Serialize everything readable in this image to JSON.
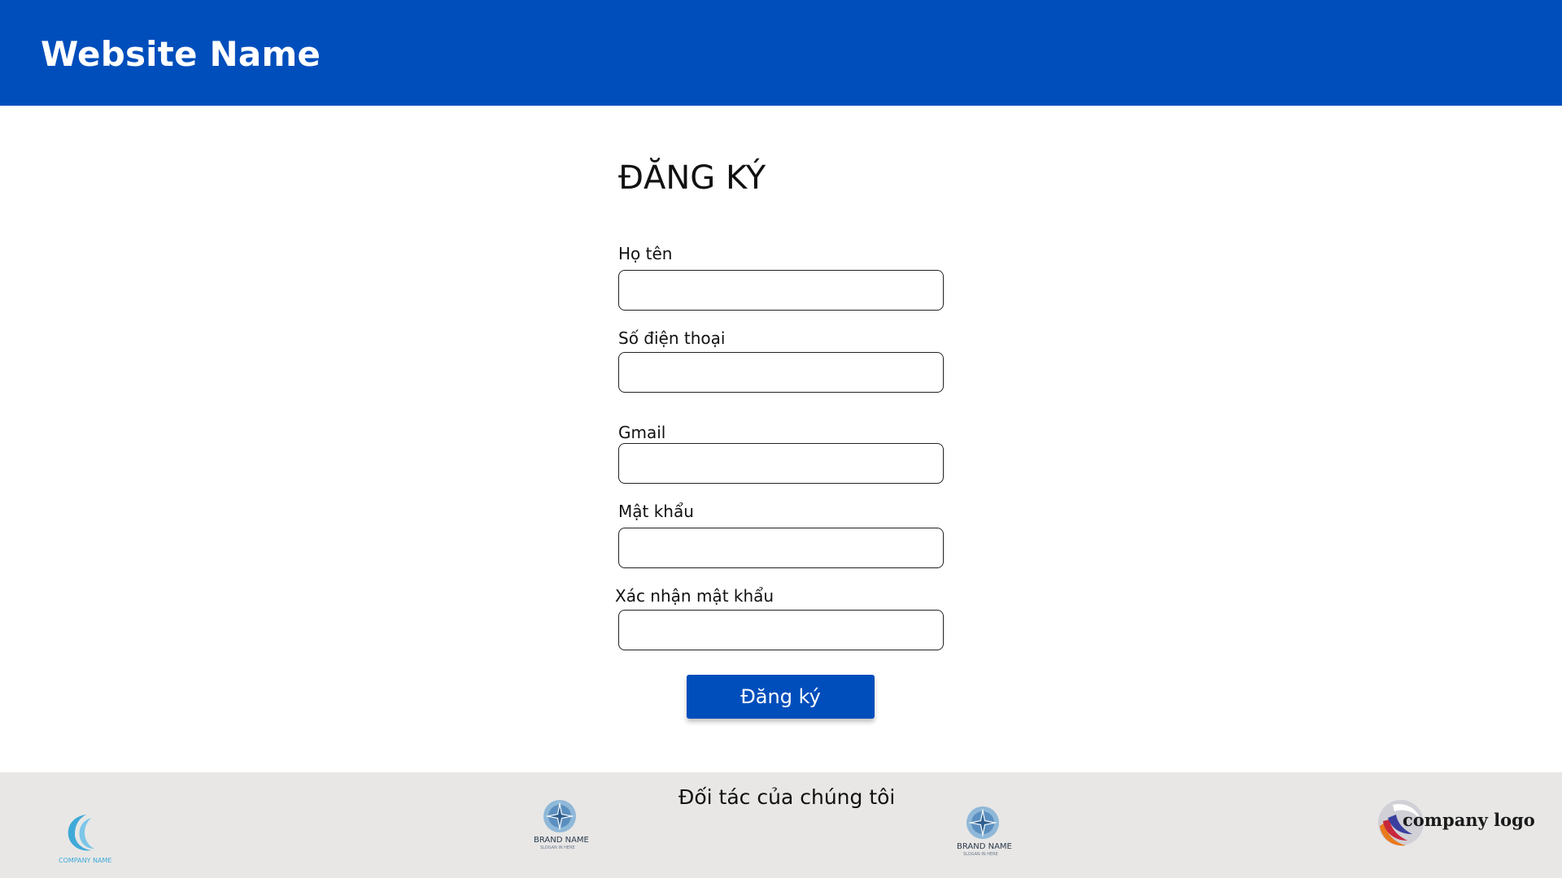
{
  "header": {
    "site_name": "Website Name",
    "background_color": "#004ebc"
  },
  "form": {
    "title": "ĐĂNG KÝ",
    "fields": [
      {
        "label": "Họ tên",
        "value": "",
        "placeholder": ""
      },
      {
        "label": "Số điện thoại",
        "value": "",
        "placeholder": ""
      },
      {
        "label": "Gmail",
        "value": "",
        "placeholder": ""
      },
      {
        "label": "Mật khẩu",
        "value": "",
        "placeholder": ""
      },
      {
        "label": "Xác nhận mật khẩu",
        "value": "",
        "placeholder": ""
      }
    ],
    "submit_label": "Đăng ký",
    "accent_color": "#004ebc"
  },
  "footer": {
    "title": "Đối tác của chúng tôi",
    "background_color": "#e8e7e6",
    "partners": [
      {
        "icon": "crescent-logo-icon",
        "caption": "COMPANY NAME"
      },
      {
        "icon": "compass-star-logo-icon",
        "caption": "BRAND NAME",
        "slogan": "SLOGAN IN HERE"
      },
      {
        "icon": "compass-star-logo-icon",
        "caption": "BRAND NAME",
        "slogan": "SLOGAN IN HERE"
      },
      {
        "icon": "swirl-sphere-logo-icon",
        "caption": "company logo"
      }
    ]
  }
}
